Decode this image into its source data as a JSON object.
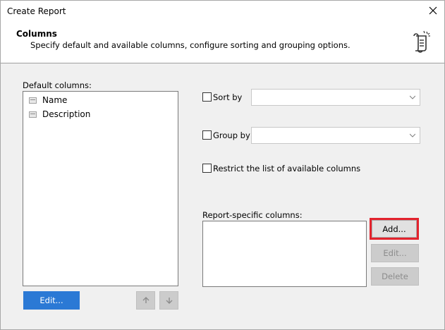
{
  "window": {
    "title": "Create Report"
  },
  "header": {
    "title": "Columns",
    "subtitle": "Specify default and available columns, configure sorting and grouping options."
  },
  "default_columns": {
    "label": "Default columns:",
    "items": [
      "Name",
      "Description"
    ],
    "edit_label": "Edit..."
  },
  "sort_by": {
    "label": "Sort by",
    "checked": false,
    "value": ""
  },
  "group_by": {
    "label": "Group by",
    "checked": false,
    "value": ""
  },
  "restrict": {
    "label": "Restrict the list of available columns",
    "checked": false
  },
  "report_specific": {
    "label": "Report-specific columns:",
    "add_label": "Add...",
    "edit_label": "Edit...",
    "delete_label": "Delete"
  },
  "icons": {
    "close": "close-icon",
    "report": "report-scroll-icon",
    "up": "arrow-up-icon",
    "down": "arrow-down-icon",
    "dropdown": "chevron-down-icon",
    "column": "column-icon"
  },
  "colors": {
    "primary": "#2b79d5",
    "highlight": "#e3232d"
  }
}
